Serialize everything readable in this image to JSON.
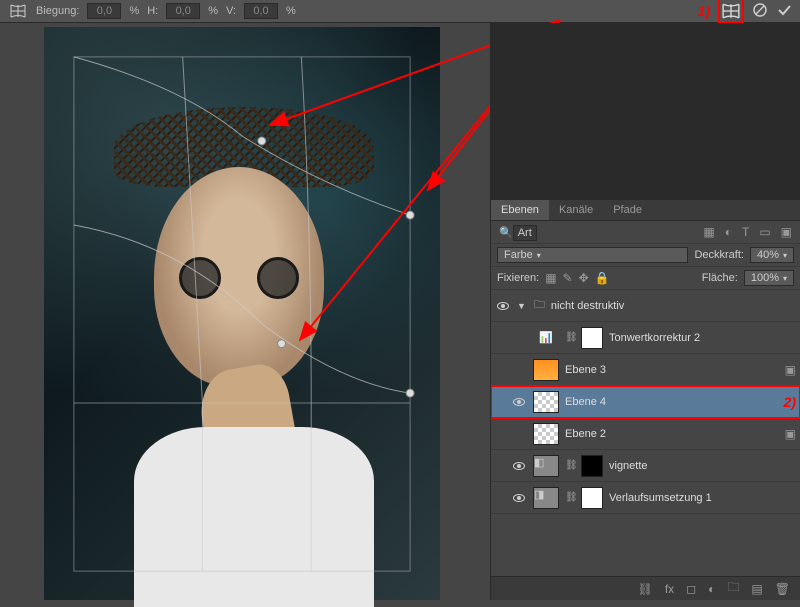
{
  "topbar": {
    "biegung_label": "Biegung:",
    "biegung_value": "0,0",
    "pct": "%",
    "h_label": "H:",
    "h_value": "0,0",
    "v_label": "V:",
    "v_value": "0,0"
  },
  "annotations": {
    "one": "1)",
    "two": "2)"
  },
  "panel": {
    "tabs": {
      "ebenen": "Ebenen",
      "kanaele": "Kanäle",
      "pfade": "Pfade"
    },
    "search_placeholder": "Art",
    "blend_mode": "Farbe",
    "opacity_label": "Deckkraft:",
    "opacity_value": "40%",
    "lock_label": "Fixieren:",
    "fill_label": "Fläche:",
    "fill_value": "100%",
    "layers": [
      {
        "name": "nicht destruktiv",
        "type": "folder"
      },
      {
        "name": "Tonwertkorrektur 2",
        "type": "adj"
      },
      {
        "name": "Ebene 3",
        "type": "orange"
      },
      {
        "name": "Ebene 4",
        "type": "checker",
        "selected": true
      },
      {
        "name": "Ebene 2",
        "type": "checker"
      },
      {
        "name": "vignette",
        "type": "adj-black"
      },
      {
        "name": "Verlaufsumsetzung 1",
        "type": "adj-gray"
      }
    ]
  }
}
